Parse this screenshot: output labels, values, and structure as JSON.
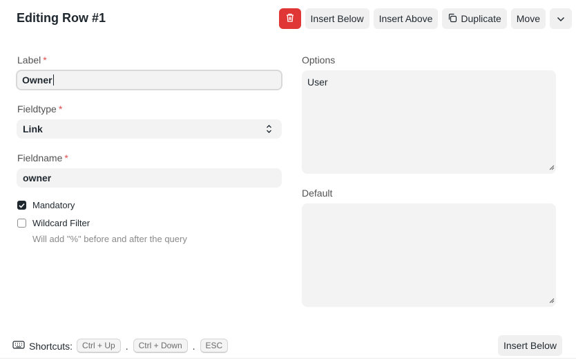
{
  "header": {
    "title": "Editing Row #1",
    "buttons": {
      "insert_below": "Insert Below",
      "insert_above": "Insert Above",
      "duplicate": "Duplicate",
      "move": "Move"
    },
    "colors": {
      "danger": "#e03636"
    }
  },
  "form": {
    "label": {
      "label": "Label",
      "required": "*",
      "value": "Owner"
    },
    "fieldtype": {
      "label": "Fieldtype",
      "required": "*",
      "value": "Link"
    },
    "fieldname": {
      "label": "Fieldname",
      "required": "*",
      "value": "owner"
    },
    "mandatory": {
      "label": "Mandatory",
      "checked": true
    },
    "wildcard": {
      "label": "Wildcard Filter",
      "checked": false,
      "hint": "Will add \"%\" before and after the query"
    },
    "options": {
      "label": "Options",
      "value": "User"
    },
    "default": {
      "label": "Default",
      "value": ""
    }
  },
  "footer": {
    "shortcuts_label": "Shortcuts:",
    "keys": [
      "Ctrl + Up",
      "Ctrl + Down",
      "ESC"
    ],
    "separator": ".",
    "insert_below": "Insert Below"
  }
}
